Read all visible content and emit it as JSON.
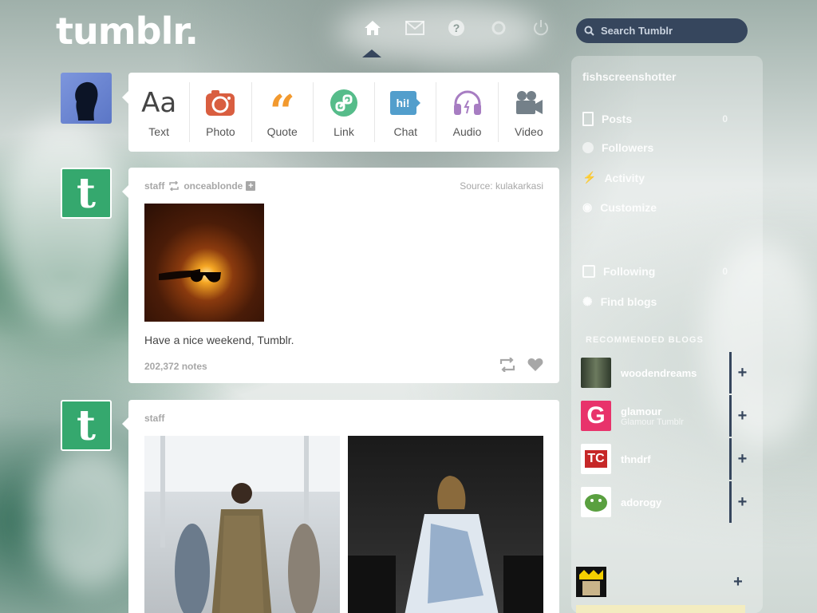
{
  "header": {
    "logo": "tumblr.",
    "search_placeholder": "Search Tumblr",
    "nav": [
      "home-icon",
      "mail-icon",
      "help-icon",
      "settings-icon",
      "power-icon"
    ]
  },
  "post_types": [
    {
      "label": "Text",
      "icon": "text-icon",
      "color": "#444444"
    },
    {
      "label": "Photo",
      "icon": "camera-icon",
      "color": "#d95e40"
    },
    {
      "label": "Quote",
      "icon": "quote-icon",
      "color": "#f2992e"
    },
    {
      "label": "Link",
      "icon": "link-icon",
      "color": "#56bc8a"
    },
    {
      "label": "Chat",
      "icon": "chat-icon",
      "color": "#529ecc"
    },
    {
      "label": "Audio",
      "icon": "headphones-icon",
      "color": "#a77dc2"
    },
    {
      "label": "Video",
      "icon": "video-camera-icon",
      "color": "#748089"
    }
  ],
  "posts": [
    {
      "author": "staff",
      "reblogged_from": "onceablonde",
      "source": "Source: kulakarkasi",
      "caption": "Have a nice weekend, Tumblr.",
      "notes": "202,372 notes"
    },
    {
      "author": "staff"
    }
  ],
  "sidebar": {
    "blog": "fishscreenshotter",
    "items": [
      {
        "label": "Posts",
        "icon": "document-icon",
        "count": "0"
      },
      {
        "label": "Followers",
        "icon": "person-icon",
        "count": ""
      },
      {
        "label": "Activity",
        "icon": "lightning-icon",
        "count": ""
      },
      {
        "label": "Customize",
        "icon": "eye-icon",
        "count": ""
      },
      {
        "label": "Following",
        "icon": "person-box-icon",
        "count": "0"
      },
      {
        "label": "Find blogs",
        "icon": "compass-icon",
        "count": ""
      }
    ],
    "recommended_title": "RECOMMENDED BLOGS",
    "recommended": [
      {
        "name": "woodendreams",
        "sub": "",
        "color": "#4a5a44"
      },
      {
        "name": "glamour",
        "sub": "Glamour Tumblr",
        "color": "#e8336b"
      },
      {
        "name": "thndrf",
        "sub": "",
        "color": "#c62828"
      },
      {
        "name": "adorogy",
        "sub": "",
        "color": "#5aa040"
      }
    ]
  },
  "colors": {
    "navy": "#36465d",
    "tumblr_green": "#35a86e"
  }
}
